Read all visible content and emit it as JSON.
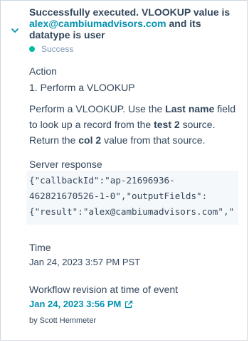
{
  "header": {
    "message_prefix": "Successfully executed. VLOOKUP value is",
    "value_link": "alex@cambiumadvisors.com",
    "message_suffix": "and its datatype is user",
    "status": "Success",
    "status_color": "#00bda5"
  },
  "action": {
    "label": "Action",
    "title": "1. Perform a VLOOKUP",
    "desc": {
      "p1": "Perform a VLOOKUP. Use the",
      "b1": "Last name",
      "p2": "field to look up a record from the",
      "b2": "test 2",
      "p3": "source. Return the",
      "b3": "col 2",
      "p4": "value from that source."
    }
  },
  "server": {
    "label": "Server response",
    "lines": [
      "{\"callbackId\":\"ap-21696936-",
      "462821670526-1-0\",\"outputFields\":",
      "{\"result\":\"alex@cambiumadvisors.com\",\""
    ]
  },
  "time": {
    "label": "Time",
    "value": "Jan 24, 2023 3:57 PM PST"
  },
  "revision": {
    "label": "Workflow revision at time of event",
    "link": "Jan 24, 2023 3:56 PM",
    "link_icon": "external-link-icon",
    "author": "by Scott Hemmeter"
  },
  "colors": {
    "text": "#33475b",
    "link": "#0091ae",
    "muted": "#7c98b6",
    "code_bg": "#f5f8fa"
  }
}
